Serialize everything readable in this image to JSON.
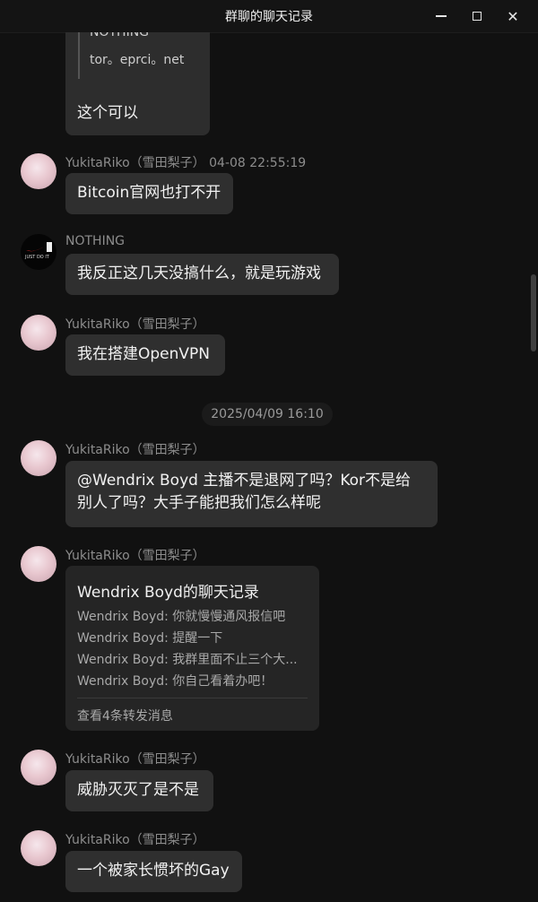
{
  "window": {
    "title": "群聊的聊天记录",
    "controls": [
      "minimize-icon",
      "maximize-icon",
      "close-icon"
    ]
  },
  "quoted": {
    "lines": [
      "NOTHING",
      "tor。eprci。net"
    ],
    "text": "这个可以"
  },
  "messages": [
    {
      "sender": "YukitaRiko（雪田梨子）  04-08 22:55:19",
      "text": "Bitcoin官网也打不开",
      "avatar": "anime-avatar"
    },
    {
      "sender": "NOTHING",
      "text": "我反正这几天没搞什么，就是玩游戏",
      "avatar": "just-do-it-avatar"
    },
    {
      "sender": "YukitaRiko（雪田梨子）",
      "text": "我在搭建OpenVPN",
      "avatar": "anime-avatar"
    },
    {
      "sender": "YukitaRiko（雪田梨子）",
      "text": "@Wendrix Boyd 主播不是退网了吗？Kor不是给别人了吗？大手子能把我们怎么样呢",
      "avatar": "anime-avatar"
    },
    {
      "sender": "YukitaRiko（雪田梨子）",
      "avatar": "anime-avatar"
    },
    {
      "sender": "YukitaRiko（雪田梨子）",
      "text": "威胁灭灭了是不是",
      "avatar": "anime-avatar"
    },
    {
      "sender": "YukitaRiko（雪田梨子）",
      "text": "一个被家长惯坏的Gay",
      "avatar": "anime-avatar"
    }
  ],
  "timestamp_divider": "2025/04/09 16:10",
  "forward_card": {
    "title": "Wendrix Boyd的聊天记录",
    "lines": [
      "Wendrix Boyd: 你就慢慢通风报信吧",
      "Wendrix Boyd: 提醒一下",
      "Wendrix Boyd: 我群里面不止三个大...",
      "Wendrix Boyd: 你自己看着办吧！"
    ],
    "footer": "查看4条转发消息"
  },
  "avatar_badge_text": "JUST DO IT"
}
